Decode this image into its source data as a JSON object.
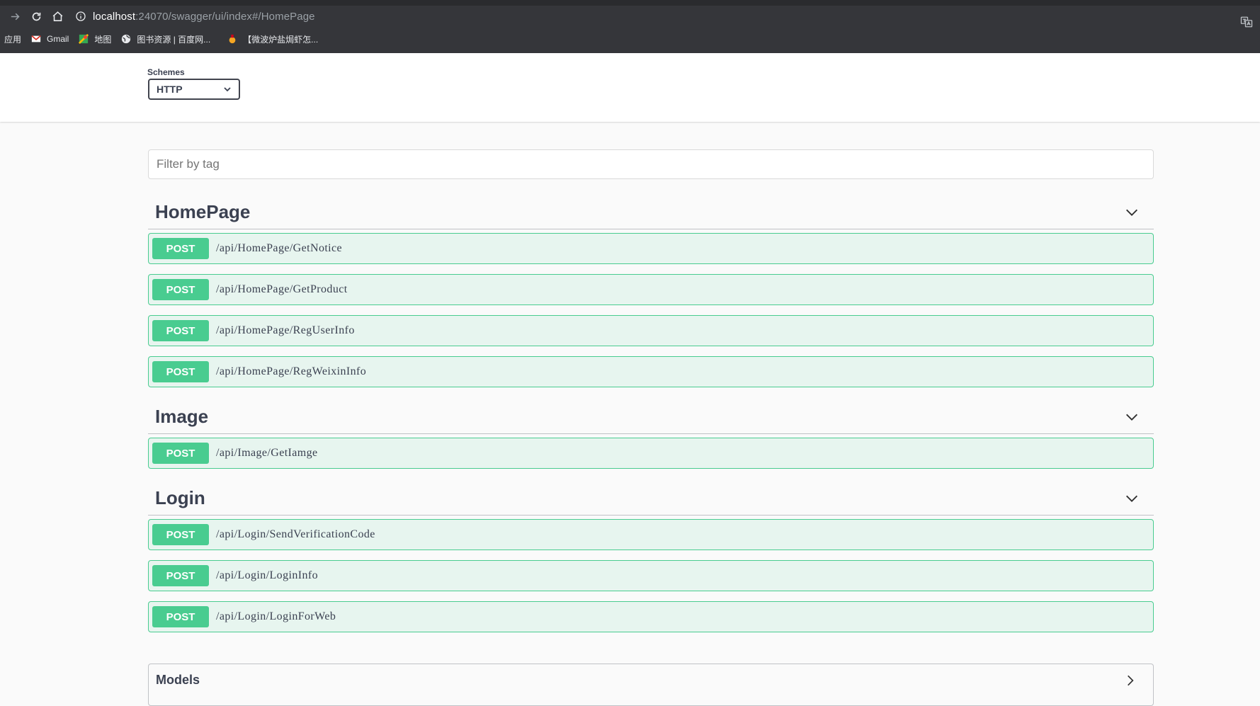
{
  "browser": {
    "url_host": "localhost",
    "url_rest": ":24070/swagger/ui/index#/HomePage",
    "bookmarks": [
      {
        "label": "应用",
        "icon": "apps-icon"
      },
      {
        "label": "Gmail",
        "icon": "gmail-icon"
      },
      {
        "label": "地图",
        "icon": "maps-icon"
      },
      {
        "label": "图书资源 | 百度网...",
        "icon": "globe-icon"
      },
      {
        "label": "【微波炉盐焗虾怎...",
        "icon": "bookmark-favicon-icon"
      }
    ]
  },
  "schemes": {
    "label": "Schemes",
    "selected": "HTTP"
  },
  "filter": {
    "placeholder": "Filter by tag"
  },
  "tags": [
    {
      "name": "HomePage",
      "operations": [
        {
          "method": "POST",
          "path": "/api/HomePage/GetNotice"
        },
        {
          "method": "POST",
          "path": "/api/HomePage/GetProduct"
        },
        {
          "method": "POST",
          "path": "/api/HomePage/RegUserInfo"
        },
        {
          "method": "POST",
          "path": "/api/HomePage/RegWeixinInfo"
        }
      ]
    },
    {
      "name": "Image",
      "operations": [
        {
          "method": "POST",
          "path": "/api/Image/GetIamge"
        }
      ]
    },
    {
      "name": "Login",
      "operations": [
        {
          "method": "POST",
          "path": "/api/Login/SendVerificationCode"
        },
        {
          "method": "POST",
          "path": "/api/Login/LoginInfo"
        },
        {
          "method": "POST",
          "path": "/api/Login/LoginForWeb"
        }
      ]
    }
  ],
  "models": {
    "title": "Models"
  },
  "colors": {
    "post": "#49cc90",
    "text": "#3b4151",
    "chrome": "#35363a"
  }
}
